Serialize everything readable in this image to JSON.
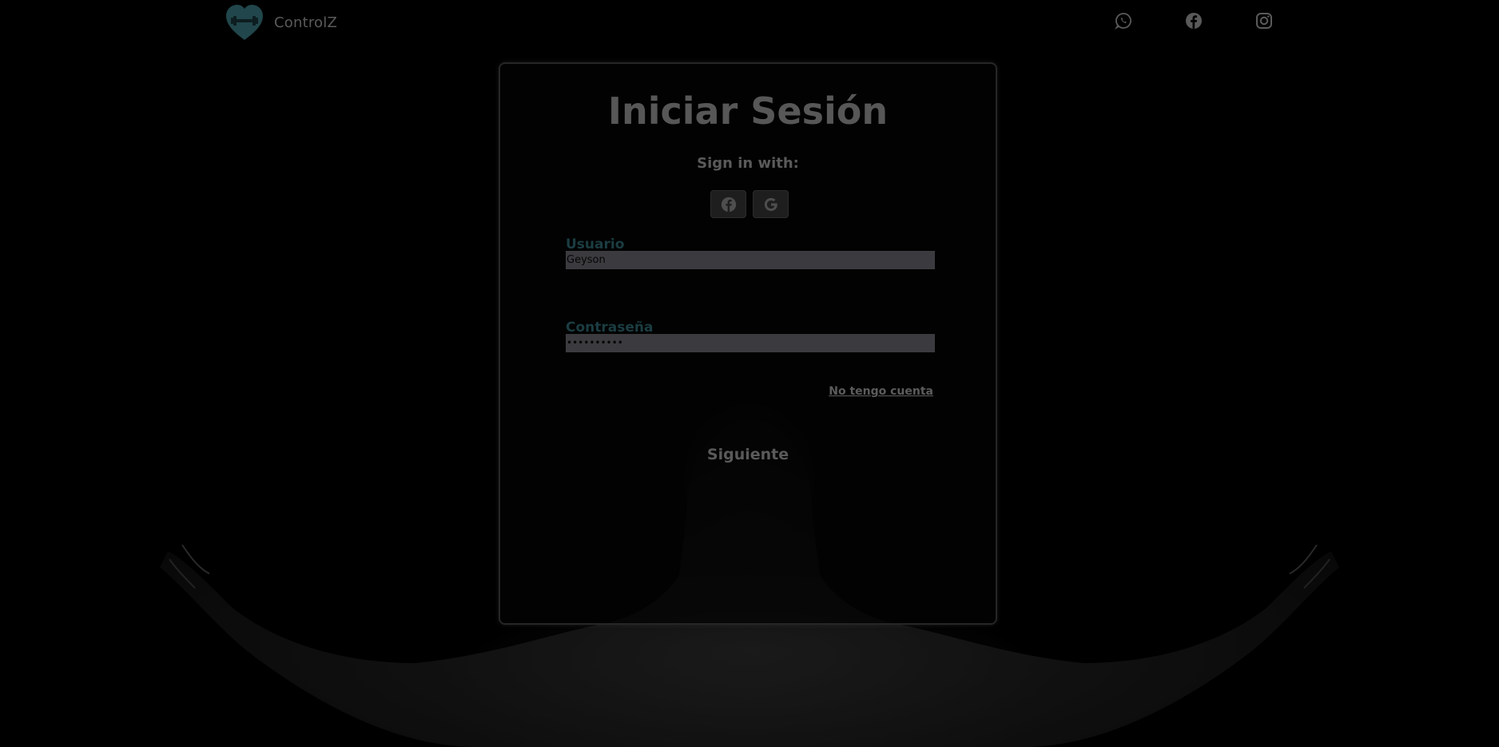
{
  "header": {
    "brand_name": "ControlZ",
    "brand_logo": "heart-dumbbell-logo",
    "social": [
      {
        "name": "whatsapp-icon"
      },
      {
        "name": "facebook-icon"
      },
      {
        "name": "instagram-icon"
      }
    ]
  },
  "login": {
    "title": "Iniciar Sesión",
    "sign_in_with": "Sign in with:",
    "oauth": [
      {
        "icon": "facebook-icon"
      },
      {
        "icon": "google-icon"
      }
    ],
    "username": {
      "label": "Usuario",
      "value": "Geyson"
    },
    "password": {
      "label": "Contraseña",
      "value": "••••••••••"
    },
    "register_link": "No tengo cuenta",
    "submit_label": "Siguiente"
  },
  "colors": {
    "background": "#000000",
    "accent": "#1b3d42",
    "logo": "#21464b",
    "text_muted": "#5a5a5a",
    "input_bg": "#3b3b3f"
  }
}
